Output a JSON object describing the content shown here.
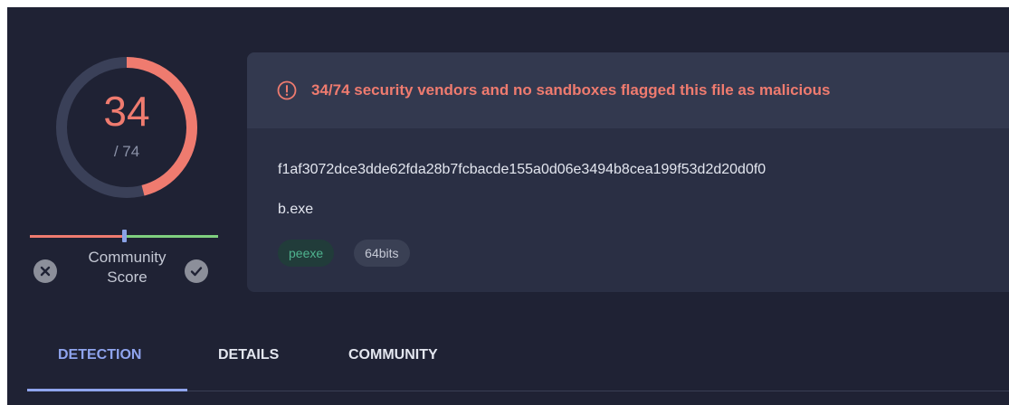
{
  "score": {
    "detections": "34",
    "total": "/ 74",
    "fraction": 0.4595,
    "ring_color": "#ef7b6f",
    "ring_track_color": "#3a4058"
  },
  "community": {
    "label_line1": "Community",
    "label_line2": "Score",
    "negative_icon": "x-circle-icon",
    "positive_icon": "check-circle-icon",
    "slider_position": 0.5
  },
  "alert": {
    "icon": "exclamation-circle-icon",
    "text": "34/74 security vendors and no sandboxes flagged this file as malicious",
    "color": "#ef7b6f"
  },
  "file": {
    "hash": "f1af3072dce3dde62fda28b7fcbacde155a0d06e3494b8cea199f53d2d20d0f0",
    "name": "b.exe",
    "tags": [
      "peexe",
      "64bits"
    ]
  },
  "tabs": [
    {
      "label": "DETECTION",
      "active": true
    },
    {
      "label": "DETAILS",
      "active": false
    },
    {
      "label": "COMMUNITY",
      "active": false
    }
  ]
}
